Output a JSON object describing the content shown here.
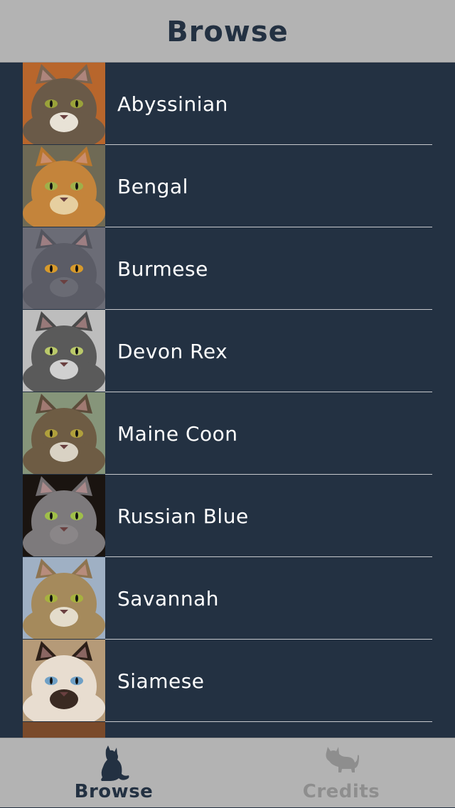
{
  "header": {
    "title": "Browse"
  },
  "breeds": [
    {
      "name": "Abyssinian",
      "colors": {
        "bg": "#b8662c",
        "fur": "#6a5a48",
        "ear": "#7a6450",
        "eye": "#9aa23a",
        "muzzle": "#e8e2d6"
      }
    },
    {
      "name": "Bengal",
      "colors": {
        "bg": "#6f6a55",
        "fur": "#c4843b",
        "ear": "#b8772f",
        "eye": "#9fb04a",
        "muzzle": "#e6cfa0"
      }
    },
    {
      "name": "Burmese",
      "colors": {
        "bg": "#6b6c76",
        "fur": "#5b5c66",
        "ear": "#54555e",
        "eye": "#d79a2b",
        "muzzle": "#6a6b74"
      }
    },
    {
      "name": "Devon Rex",
      "colors": {
        "bg": "#bdbdbd",
        "fur": "#5a5a5a",
        "ear": "#4a4a4a",
        "eye": "#bac96a",
        "muzzle": "#d0d0d0"
      }
    },
    {
      "name": "Maine Coon",
      "colors": {
        "bg": "#86957a",
        "fur": "#6e5c44",
        "ear": "#5c4c3a",
        "eye": "#b0a03c",
        "muzzle": "#d9d2c4"
      }
    },
    {
      "name": "Russian Blue",
      "colors": {
        "bg": "#1a1410",
        "fur": "#7d7a7c",
        "ear": "#726e70",
        "eye": "#9fbf49",
        "muzzle": "#8a8688"
      }
    },
    {
      "name": "Savannah",
      "colors": {
        "bg": "#9fb0c4",
        "fur": "#a58a5c",
        "ear": "#8e7450",
        "eye": "#a7b23f",
        "muzzle": "#e4dccb"
      }
    },
    {
      "name": "Siamese",
      "colors": {
        "bg": "#b59a78",
        "fur": "#e8ddd0",
        "ear": "#2c1f18",
        "eye": "#6fa0c6",
        "muzzle": "#3a2a22"
      }
    }
  ],
  "partial_row": {
    "colors": {
      "bg": "#7a4a2a"
    }
  },
  "tabbar": {
    "tabs": [
      {
        "label": "Browse",
        "icon": "cat-sitting-icon",
        "active": true
      },
      {
        "label": "Credits",
        "icon": "cat-lying-icon",
        "active": false
      }
    ]
  },
  "colors": {
    "background": "#233142",
    "bars": "#b3b3b3",
    "active_tint": "#233142",
    "inactive_tint": "#8e8e8e",
    "separator": "#c7c9cd"
  }
}
